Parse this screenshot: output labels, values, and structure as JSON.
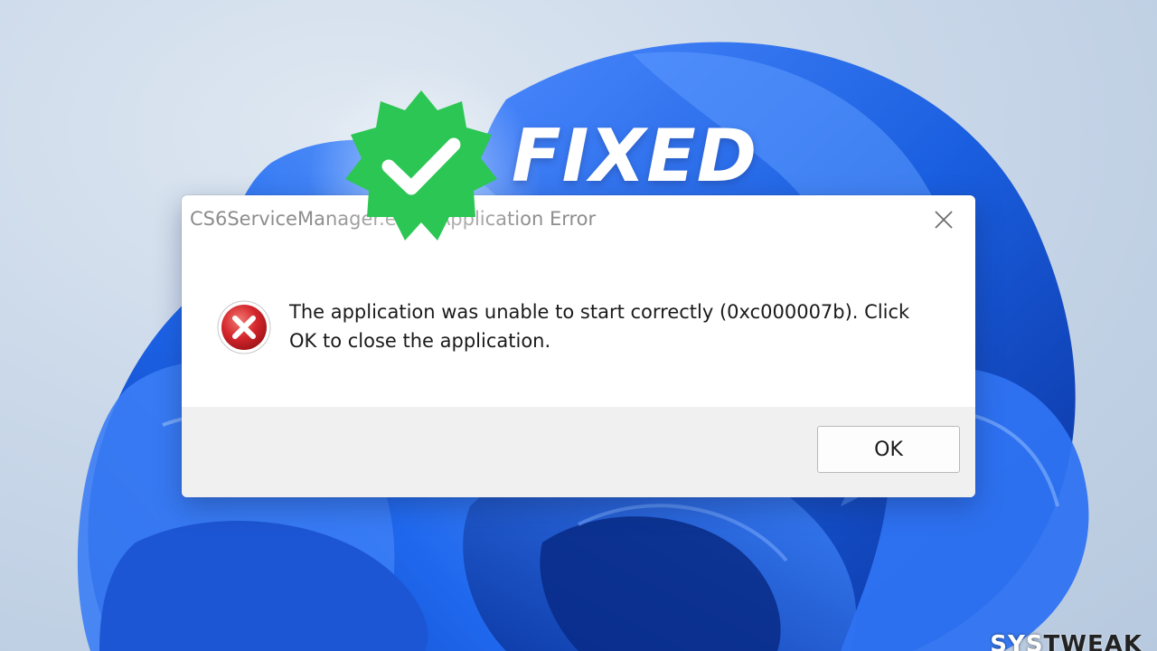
{
  "colors": {
    "accent_blue": "#1a5fe0",
    "badge_green": "#2bc653",
    "error_red": "#d4262c",
    "footer_gray": "#f0f0f0"
  },
  "banner": {
    "heading": "FIXED",
    "badge_icon": "check-badge-icon"
  },
  "dialog": {
    "title": "CS6ServiceManager.exe - Application Error",
    "close_icon": "close-icon",
    "error_icon": "error-x-icon",
    "message": "The application was unable to start correctly (0xc000007b). Click OK to close the application.",
    "ok_label": "OK"
  },
  "watermark": {
    "brand_a": "SYS",
    "brand_b": "TWEAK"
  }
}
